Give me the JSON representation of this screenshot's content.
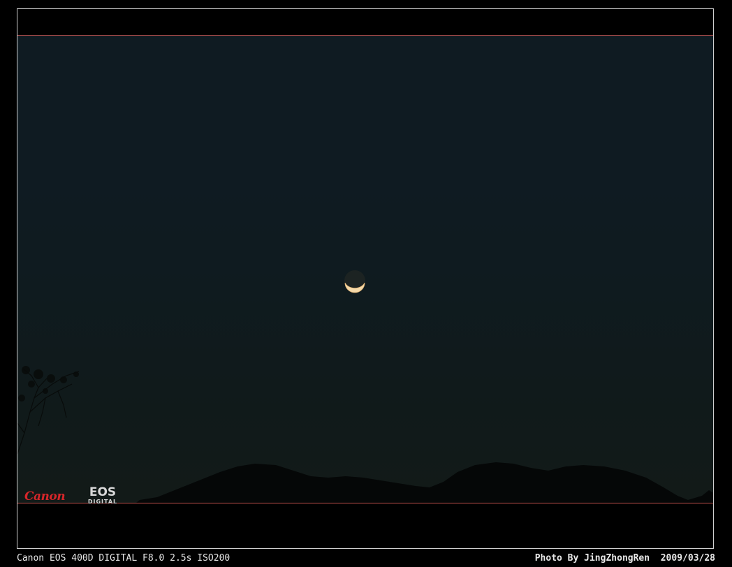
{
  "photo": {
    "subject": "crescent-moon",
    "sky_color": "#0f1b22",
    "frame_line_color": "#c0504d"
  },
  "logo": {
    "brand": "Canon",
    "line": "EOS",
    "sub": "DIGITAL"
  },
  "caption": {
    "left": "Canon EOS 400D DIGITAL F8.0 2.5s ISO200",
    "right": "Photo By JingZhongRen  2009/03/28"
  }
}
